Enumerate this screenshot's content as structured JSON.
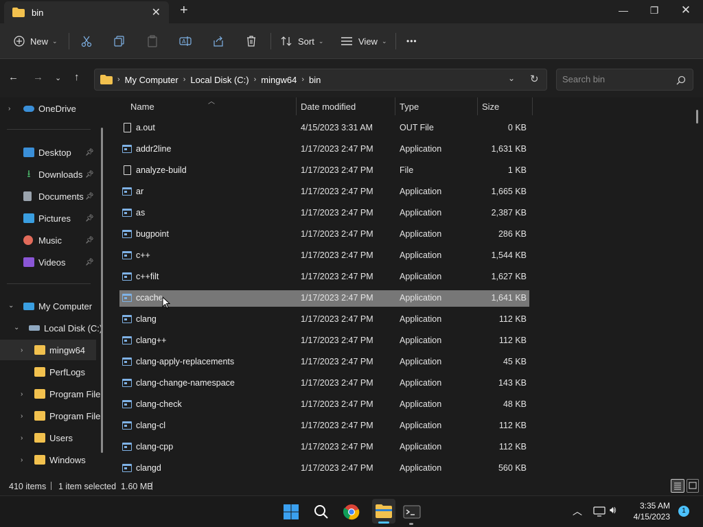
{
  "window": {
    "tab_title": "bin",
    "icons": [
      "folder-icon",
      "close-icon",
      "plus-icon",
      "minimize-icon",
      "maximize-icon",
      "close-window-icon"
    ]
  },
  "toolbar": {
    "new_label": "New",
    "sort_label": "Sort",
    "view_label": "View",
    "more_label": "•••"
  },
  "address": {
    "crumbs": [
      "My Computer",
      "Local Disk (C:)",
      "mingw64",
      "bin"
    ]
  },
  "search": {
    "placeholder": "Search bin"
  },
  "sidebar": {
    "onedrive": "OneDrive",
    "quick": [
      {
        "label": "Desktop",
        "icon": "desktop-icon",
        "color": "#3a8fd8"
      },
      {
        "label": "Downloads",
        "icon": "download-icon",
        "color": "#4bb56a"
      },
      {
        "label": "Documents",
        "icon": "document-icon",
        "color": "#9aa3ad"
      },
      {
        "label": "Pictures",
        "icon": "pictures-icon",
        "color": "#3a9ee0"
      },
      {
        "label": "Music",
        "icon": "music-icon",
        "color": "#e26b5a"
      },
      {
        "label": "Videos",
        "icon": "videos-icon",
        "color": "#8a56d6"
      }
    ],
    "my_computer": "My Computer",
    "local_disk": "Local Disk (C:)",
    "folders": [
      "mingw64",
      "PerfLogs",
      "Program File",
      "Program File",
      "Users",
      "Windows"
    ]
  },
  "columns": {
    "name": "Name",
    "date": "Date modified",
    "type": "Type",
    "size": "Size"
  },
  "files": [
    {
      "name": "a.out",
      "date": "4/15/2023 3:31 AM",
      "type": "OUT File",
      "size": "0 KB",
      "icon": "file"
    },
    {
      "name": "addr2line",
      "date": "1/17/2023 2:47 PM",
      "type": "Application",
      "size": "1,631 KB",
      "icon": "app"
    },
    {
      "name": "analyze-build",
      "date": "1/17/2023 2:47 PM",
      "type": "File",
      "size": "1 KB",
      "icon": "file"
    },
    {
      "name": "ar",
      "date": "1/17/2023 2:47 PM",
      "type": "Application",
      "size": "1,665 KB",
      "icon": "app"
    },
    {
      "name": "as",
      "date": "1/17/2023 2:47 PM",
      "type": "Application",
      "size": "2,387 KB",
      "icon": "app"
    },
    {
      "name": "bugpoint",
      "date": "1/17/2023 2:47 PM",
      "type": "Application",
      "size": "286 KB",
      "icon": "app"
    },
    {
      "name": "c++",
      "date": "1/17/2023 2:47 PM",
      "type": "Application",
      "size": "1,544 KB",
      "icon": "app"
    },
    {
      "name": "c++filt",
      "date": "1/17/2023 2:47 PM",
      "type": "Application",
      "size": "1,627 KB",
      "icon": "app"
    },
    {
      "name": "ccache",
      "date": "1/17/2023 2:47 PM",
      "type": "Application",
      "size": "1,641 KB",
      "icon": "app",
      "selected": true
    },
    {
      "name": "clang",
      "date": "1/17/2023 2:47 PM",
      "type": "Application",
      "size": "112 KB",
      "icon": "app"
    },
    {
      "name": "clang++",
      "date": "1/17/2023 2:47 PM",
      "type": "Application",
      "size": "112 KB",
      "icon": "app"
    },
    {
      "name": "clang-apply-replacements",
      "date": "1/17/2023 2:47 PM",
      "type": "Application",
      "size": "45 KB",
      "icon": "app"
    },
    {
      "name": "clang-change-namespace",
      "date": "1/17/2023 2:47 PM",
      "type": "Application",
      "size": "143 KB",
      "icon": "app"
    },
    {
      "name": "clang-check",
      "date": "1/17/2023 2:47 PM",
      "type": "Application",
      "size": "48 KB",
      "icon": "app"
    },
    {
      "name": "clang-cl",
      "date": "1/17/2023 2:47 PM",
      "type": "Application",
      "size": "112 KB",
      "icon": "app"
    },
    {
      "name": "clang-cpp",
      "date": "1/17/2023 2:47 PM",
      "type": "Application",
      "size": "112 KB",
      "icon": "app"
    },
    {
      "name": "clangd",
      "date": "1/17/2023 2:47 PM",
      "type": "Application",
      "size": "560 KB",
      "icon": "app"
    }
  ],
  "status": {
    "count": "410 items",
    "selection": "1 item selected  1.60 MB"
  },
  "taskbar": {
    "time": "3:35 AM",
    "date": "4/15/2023",
    "notifications": "1"
  },
  "colors": {
    "accent": "#4cc2ff",
    "folder": "#f2c14e",
    "selected_row": "#777777"
  }
}
